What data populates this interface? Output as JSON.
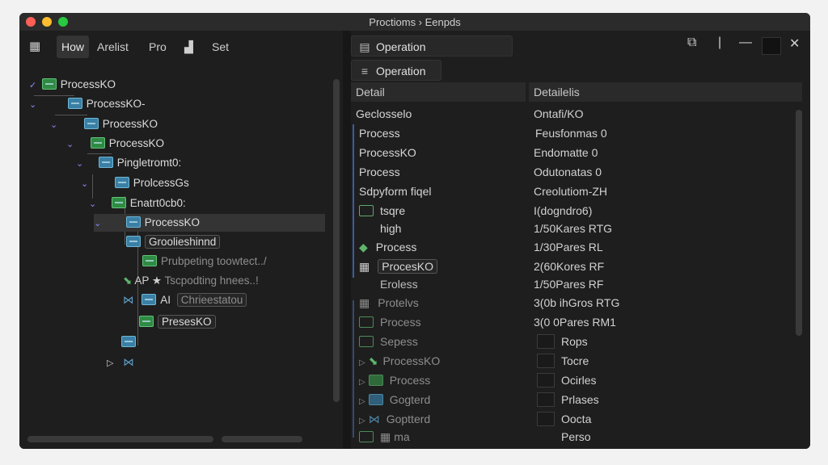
{
  "window": {
    "title": "Proctioms › Eenpds",
    "traffic_colors": [
      "#ff5f57",
      "#febc2e",
      "#28c840"
    ]
  },
  "left_toolbar": {
    "tabs": [
      "How",
      "Arelist",
      "Pro",
      "Set"
    ]
  },
  "tree": {
    "items": [
      "ProcessKO",
      "ProcessKO-",
      "ProcessKO",
      "ProcessKO",
      "Pingletromt0:",
      "ProlcessGs",
      "Enatrt0cb0:",
      "ProcessKO",
      "Groolieshinnd",
      "Prubpeting toowtect../",
      "AP",
      "Tscpodting hnees..!",
      "AI",
      "Chrieestatou",
      "PresesKO"
    ]
  },
  "right_header": {
    "tab1": "Operation",
    "tab2": "Operation"
  },
  "table": {
    "headers": [
      "Detail",
      "Detailelis"
    ],
    "rows": [
      [
        "Geclosselo",
        "Ontafi/KO"
      ],
      [
        "Process",
        "Feusfonmas 0"
      ],
      [
        "ProcessKO",
        "Endomatte 0"
      ],
      [
        "Process",
        "Odutonatas 0"
      ],
      [
        "Sdpyform fiqel",
        "Creolutiom-ZH"
      ],
      [
        "tsqre",
        "I(dogndro6)"
      ],
      [
        "high",
        "1/50Kares RTG"
      ],
      [
        "Process",
        "1/30Pares RL"
      ],
      [
        "ProcesKO",
        "2(60Kores RF"
      ],
      [
        "Eroless",
        "1/50Pares RF"
      ],
      [
        "Protelvs",
        "3(0b ihGros RTG"
      ],
      [
        "Process",
        "3(0 0Pares RM1"
      ]
    ],
    "lower_rows": [
      [
        "Sepess",
        "Rops"
      ],
      [
        "ProcessKO",
        "Tocre"
      ],
      [
        "Process",
        "Ocirles"
      ],
      [
        "Gogterd",
        "Prlases"
      ],
      [
        "Goptterd",
        "Oocta"
      ],
      [
        "ma",
        "Perso"
      ]
    ]
  }
}
